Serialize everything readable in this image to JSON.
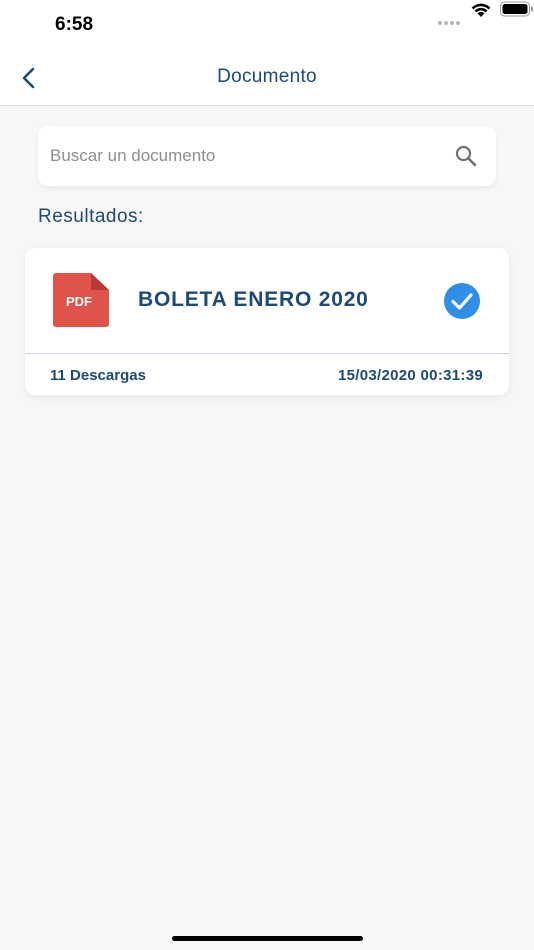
{
  "status_bar": {
    "time": "6:58"
  },
  "nav": {
    "title": "Documento",
    "back_icon": "chevron-left-icon"
  },
  "search": {
    "placeholder": "Buscar un documento",
    "value": "",
    "icon": "search-icon"
  },
  "results": {
    "label": "Resultados:",
    "items": [
      {
        "icon": "pdf-file-icon",
        "icon_label": "PDF",
        "name": "BOLETA ENERO 2020",
        "status_icon": "check-circle-icon",
        "downloads": "11 Descargas",
        "date": "15/03/2020 00:31:39"
      }
    ]
  },
  "colors": {
    "primary": "#1e4a78",
    "pdf_red": "#e0534a",
    "check_blue": "#2f8fe6",
    "background": "#f7f7f8"
  }
}
